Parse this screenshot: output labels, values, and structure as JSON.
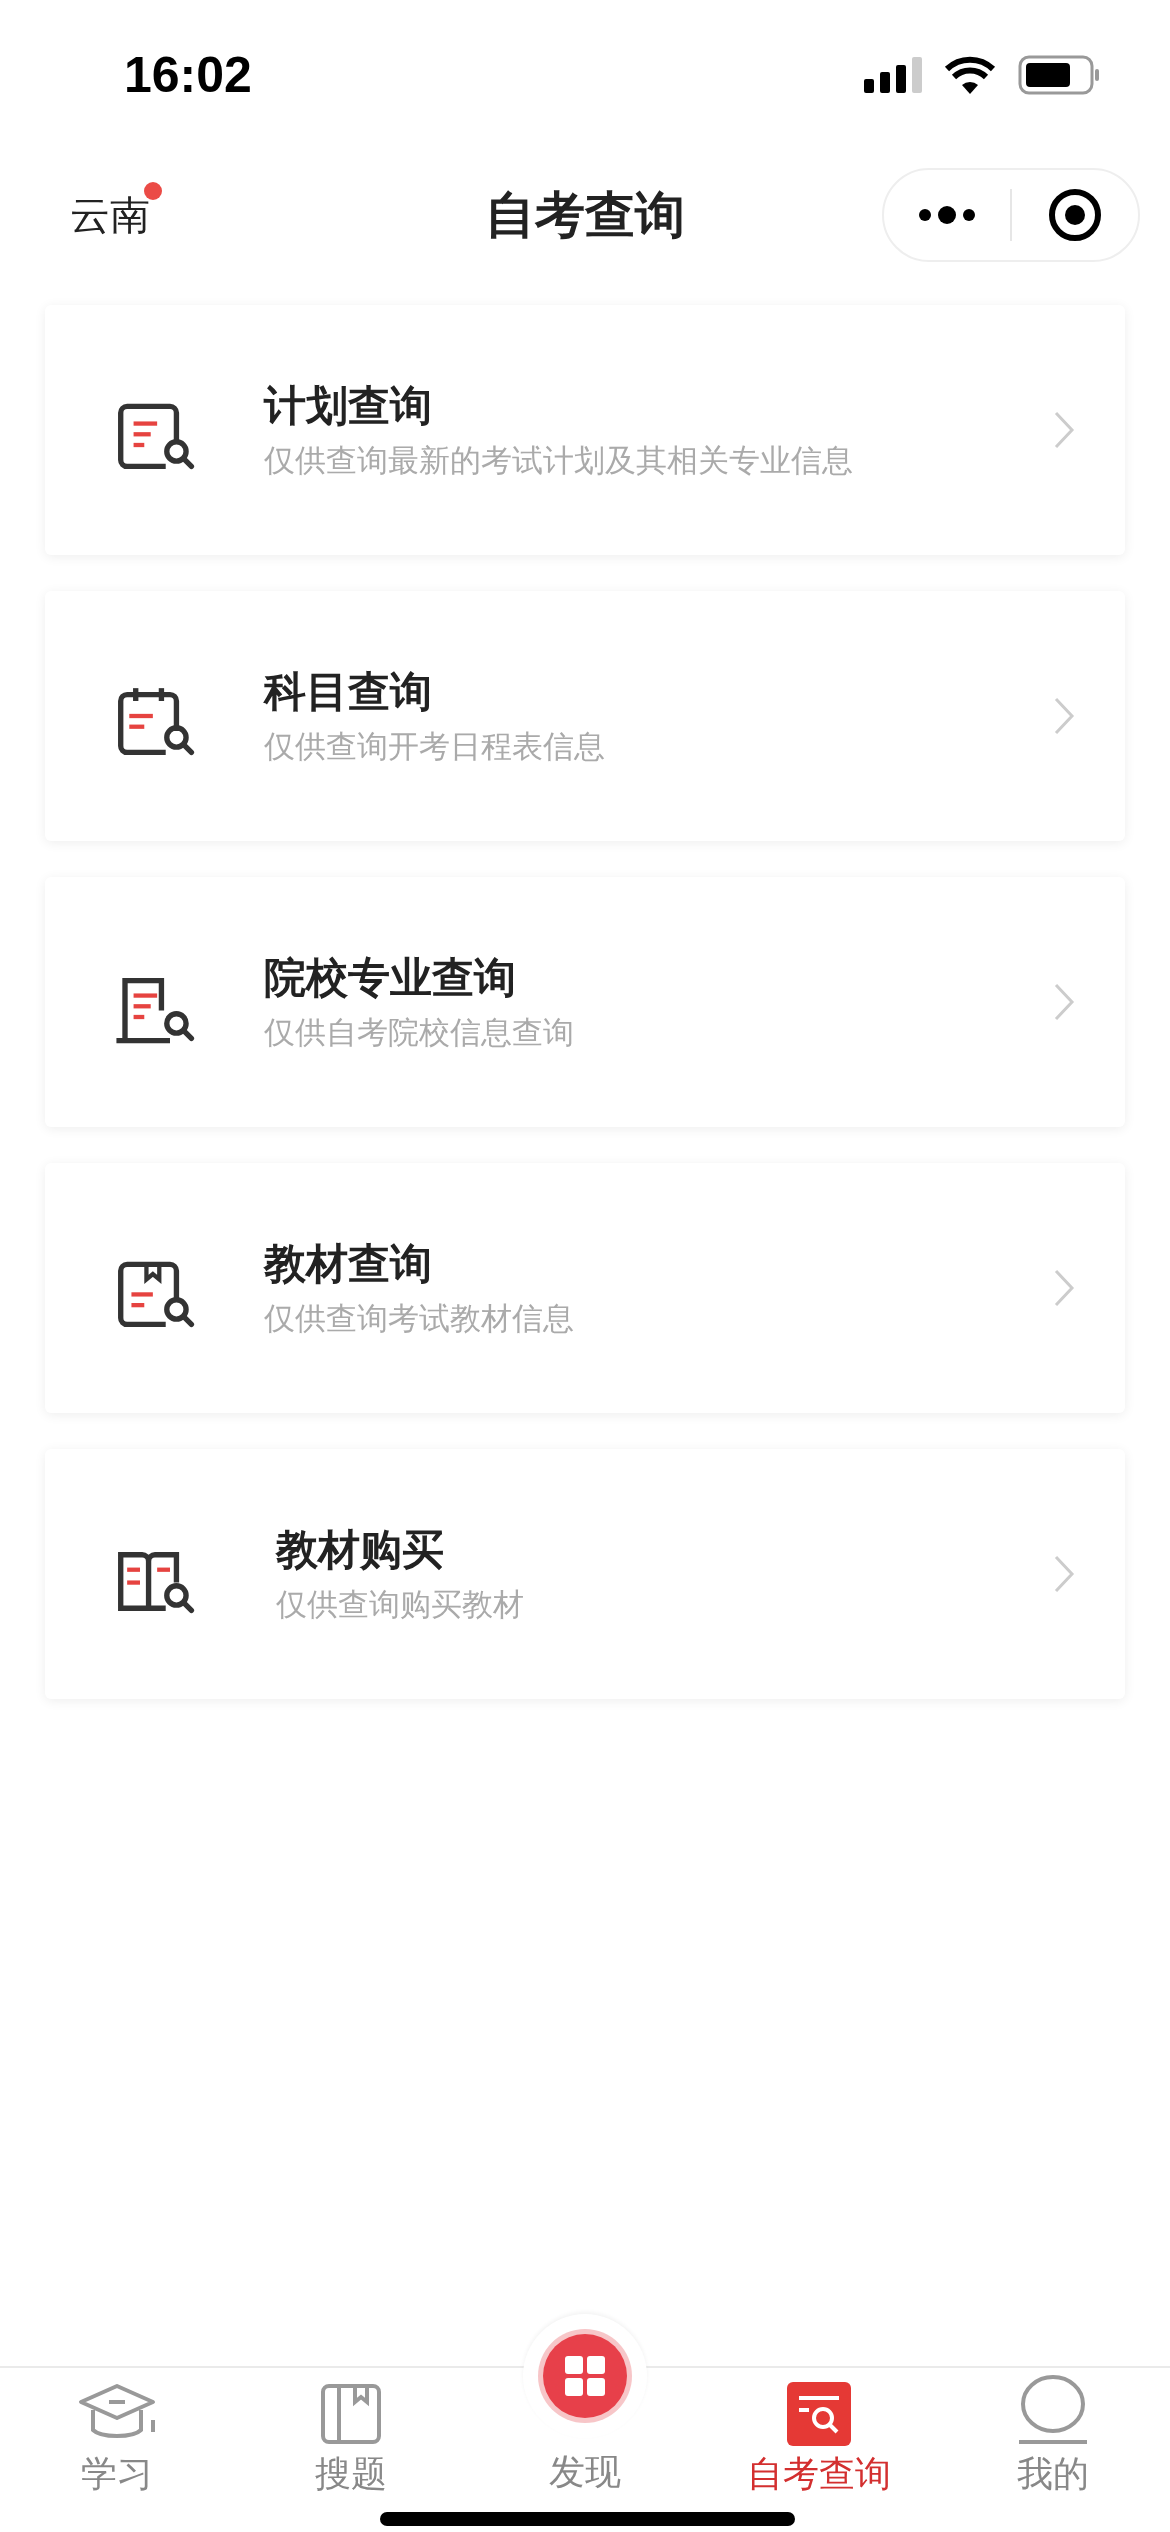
{
  "status_bar": {
    "time": "16:02"
  },
  "nav": {
    "region": "云南",
    "region_badge": true,
    "title": "自考查询"
  },
  "items": [
    {
      "kind": "plan",
      "title": "计划查询",
      "subtitle": "仅供查询最新的考试计划及其相关专业信息"
    },
    {
      "kind": "calendar",
      "title": "科目查询",
      "subtitle": "仅供查询开考日程表信息"
    },
    {
      "kind": "school",
      "title": "院校专业查询",
      "subtitle": "仅供自考院校信息查询"
    },
    {
      "kind": "book",
      "title": "教材查询",
      "subtitle": "仅供查询考试教材信息"
    },
    {
      "kind": "purchase",
      "title": "教材购买",
      "subtitle": "仅供查询购买教材"
    }
  ],
  "tabs": [
    {
      "kind": "study",
      "label": "学习",
      "selected": false
    },
    {
      "kind": "questions",
      "label": "搜题",
      "selected": false
    },
    {
      "kind": "discover",
      "label": "发现",
      "selected": false
    },
    {
      "kind": "query",
      "label": "自考查询",
      "selected": true
    },
    {
      "kind": "me",
      "label": "我的",
      "selected": false
    }
  ]
}
